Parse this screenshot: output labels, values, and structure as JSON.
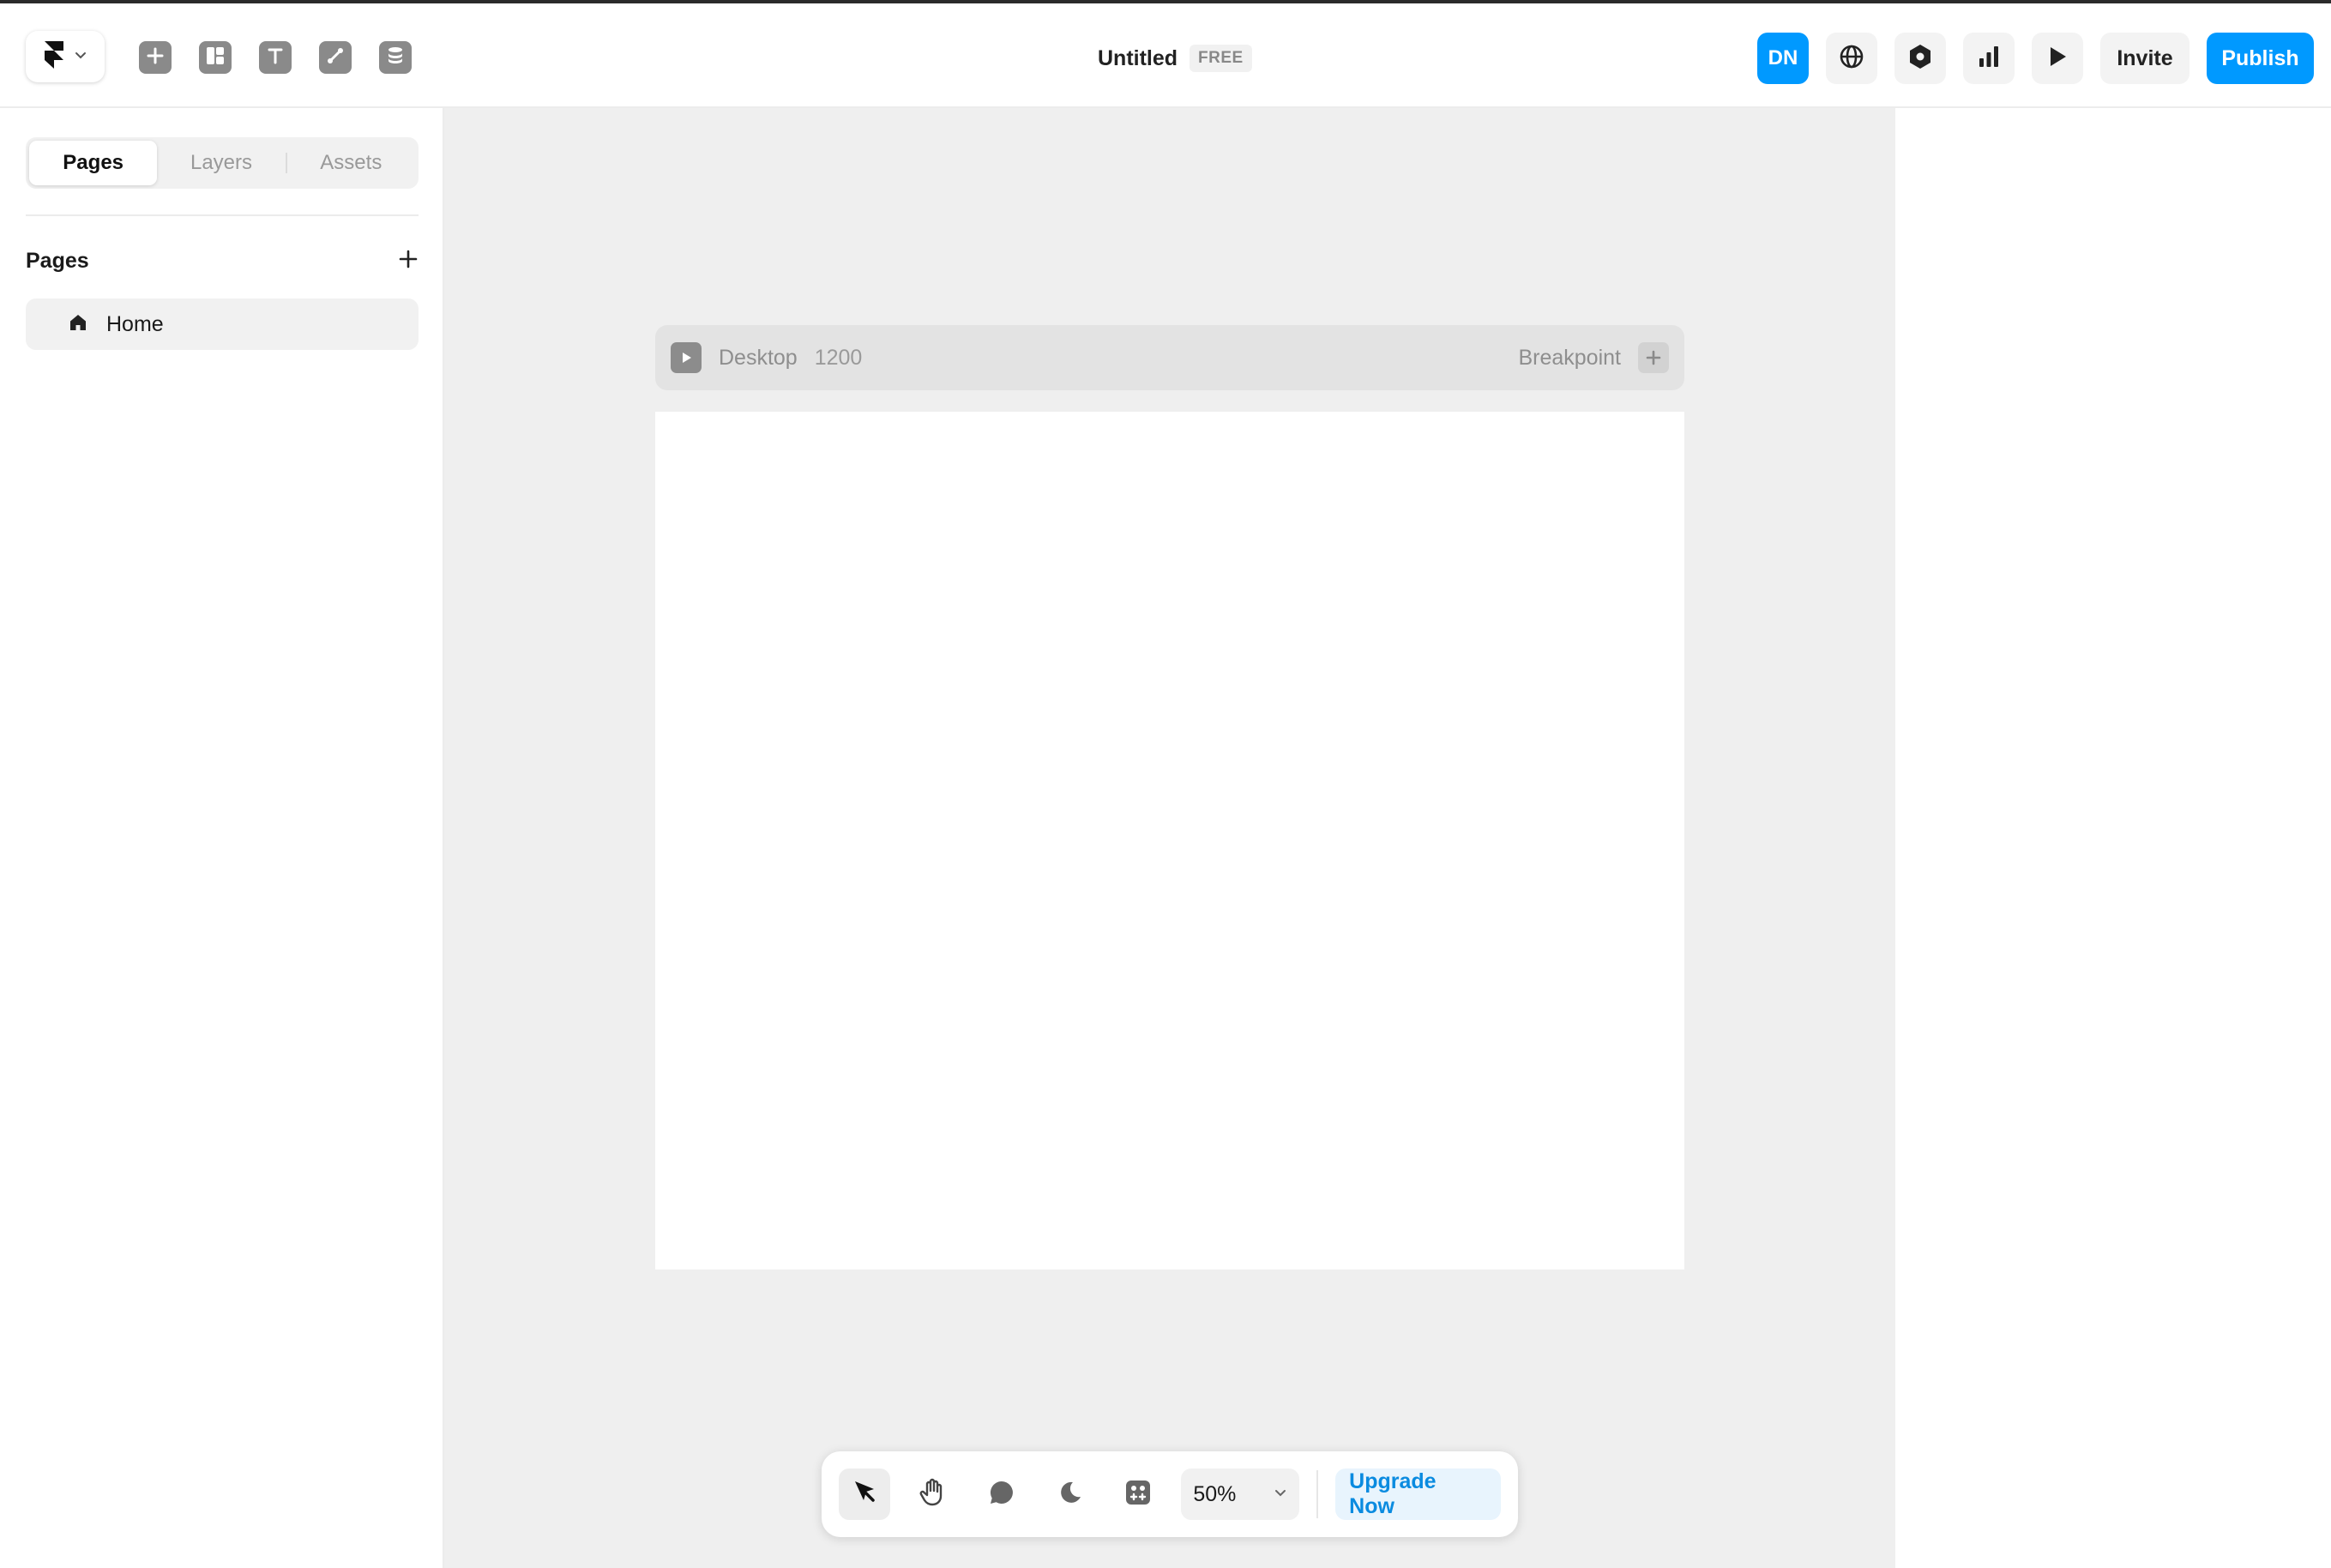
{
  "app": {
    "title": "Untitled",
    "plan_badge": "FREE"
  },
  "toolbar": {
    "insert_icon": "plus-square-icon",
    "layout_icon": "layout-icon",
    "text_icon": "text-icon",
    "vector_icon": "pen-icon",
    "cms_icon": "database-icon"
  },
  "header_right": {
    "avatar_initials": "DN",
    "invite_label": "Invite",
    "publish_label": "Publish"
  },
  "left_panel": {
    "tabs": [
      {
        "label": "Pages"
      },
      {
        "label": "Layers"
      },
      {
        "label": "Assets"
      }
    ],
    "active_tab": "Pages",
    "section_title": "Pages",
    "pages": [
      {
        "label": "Home"
      }
    ]
  },
  "canvas": {
    "breakpoint_name": "Desktop",
    "breakpoint_width": "1200",
    "breakpoint_label": "Breakpoint"
  },
  "bottom_toolbar": {
    "zoom": "50%",
    "upgrade_label": "Upgrade Now"
  },
  "colors": {
    "accent": "#0099ff",
    "canvas_bg": "#efefef",
    "upgrade_text": "#0a8be0"
  }
}
